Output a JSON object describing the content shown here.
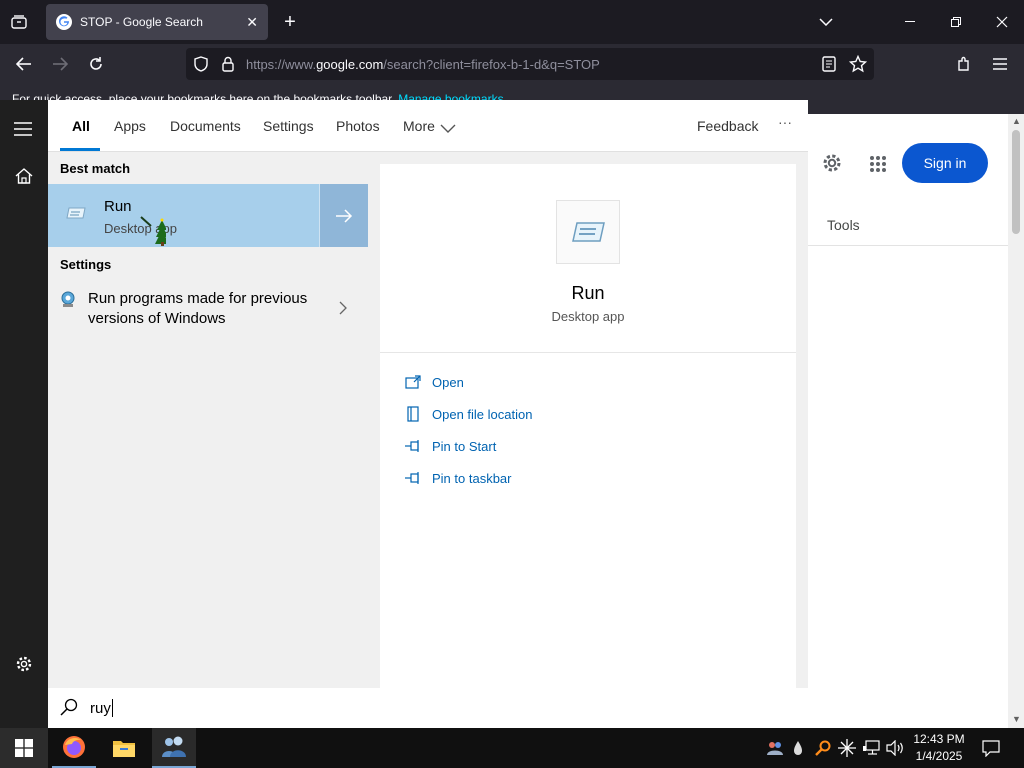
{
  "browser": {
    "tab_title": "STOP - Google Search",
    "url_prefix": "https://www.",
    "url_host": "google.com",
    "url_rest": "/search?client=firefox-b-1-d&q=STOP",
    "bookmarks_prompt": "For quick access, place your bookmarks here on the bookmarks toolbar.",
    "bookmarks_link": "Manage bookmarks"
  },
  "google": {
    "sign_in": "Sign in",
    "tools": "Tools"
  },
  "start_menu": {
    "filters": [
      "All",
      "Apps",
      "Documents",
      "Settings",
      "Photos",
      "More"
    ],
    "feedback": "Feedback",
    "more_options": "···",
    "best_match_heading": "Best match",
    "best_match": {
      "title": "Run",
      "subtitle": "Desktop app"
    },
    "settings_heading": "Settings",
    "settings_item": {
      "line1": "Run programs made for previous",
      "line2": "versions of Windows"
    },
    "preview": {
      "title": "Run",
      "subtitle": "Desktop app",
      "actions": [
        "Open",
        "Open file location",
        "Pin to Start",
        "Pin to taskbar"
      ]
    },
    "search_query": "ruy"
  },
  "taskbar": {
    "time": "12:43 PM",
    "date": "1/4/2025"
  },
  "colors": {
    "accent": "#0078d4",
    "selection": "#a7cfeb",
    "link_action": "#0063b1",
    "google_blue": "#0b57d0"
  }
}
